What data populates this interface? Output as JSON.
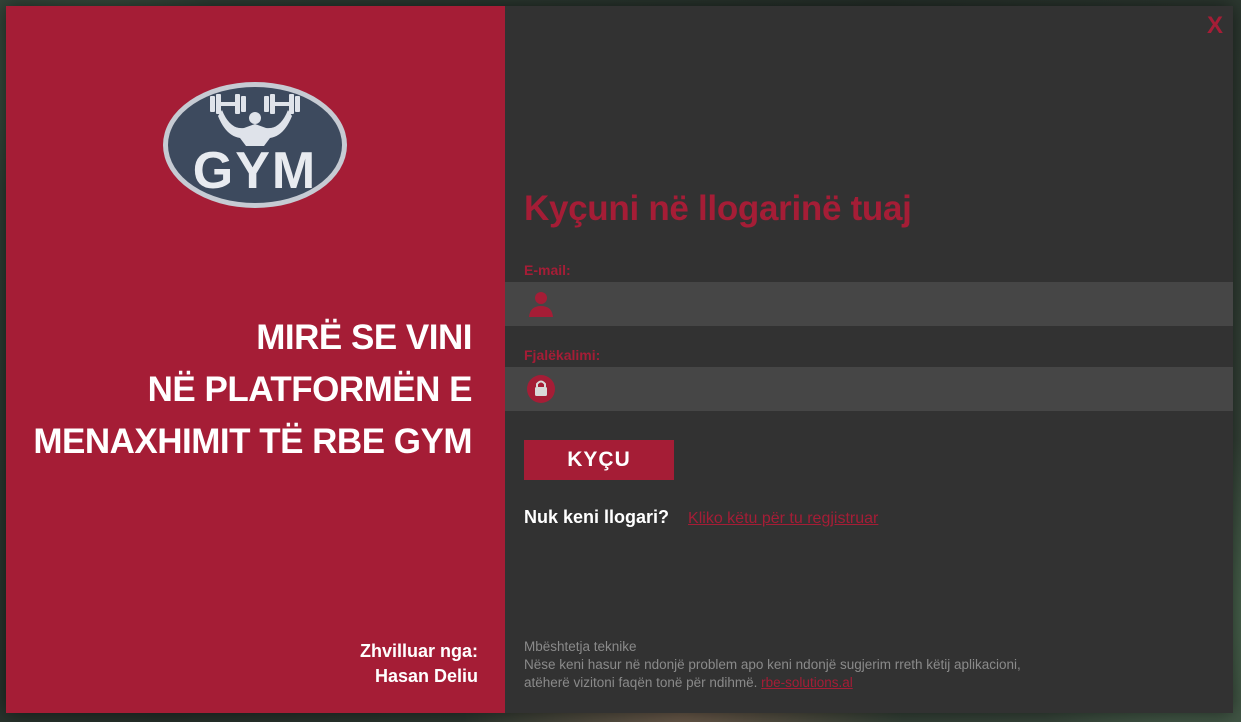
{
  "left_panel": {
    "logo_text": "GYM",
    "welcome_lines": [
      "MIRË SE VINI",
      "NË PLATFORMËN E",
      "MENAXHIMIT TË RBE GYM"
    ],
    "developed_by_label": "Zhvilluar nga:",
    "developer_name": "Hasan Deliu"
  },
  "right_panel": {
    "close_label": "X",
    "title": "Kyçuni në llogarinë tuaj",
    "email": {
      "label": "E-mail:",
      "value": "",
      "icon": "user-icon"
    },
    "password": {
      "label": "Fjalëkalimi:",
      "value": "",
      "icon": "lock-icon"
    },
    "login_button": "KYÇU",
    "no_account_text": "Nuk keni llogari?",
    "register_link": "Kliko këtu për tu regjistruar",
    "support": {
      "heading": "Mbështetja teknike",
      "line1": "Nëse keni hasur në ndonjë problem apo keni ndonjë sugjerim rreth këtij aplikacioni,",
      "line2": "atëherë vizitoni faqën tonë për ndihmë.",
      "link": "rbe-solutions.al"
    }
  },
  "colors": {
    "accent": "#a51d36",
    "dark_panel": "#323232",
    "input_bg": "#464646",
    "logo_oval": "#3d4a5e"
  }
}
